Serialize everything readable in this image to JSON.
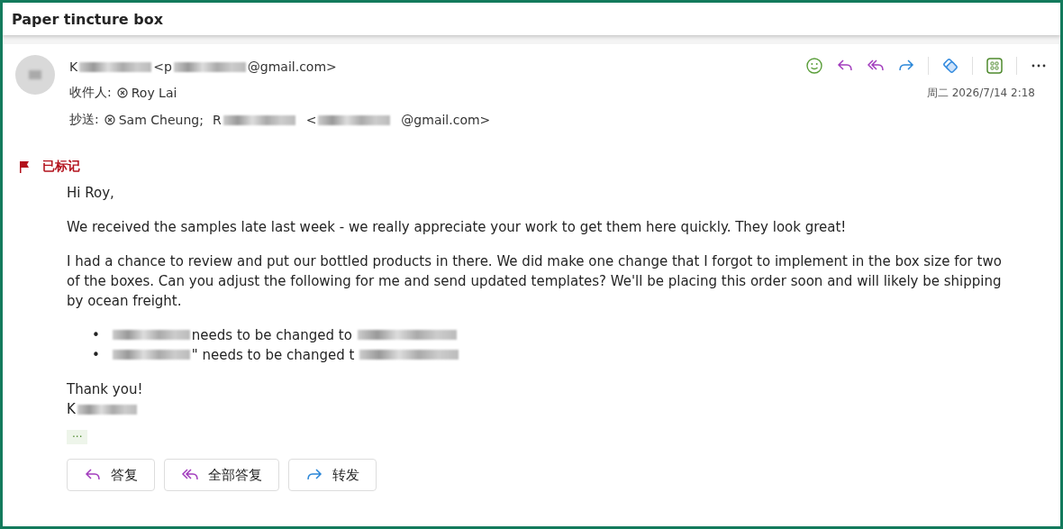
{
  "subject": "Paper tincture box",
  "sender": [
    {
      "kind": "text",
      "text": "K"
    },
    {
      "kind": "redacted"
    },
    {
      "kind": "text",
      "text": "<p"
    },
    {
      "kind": "redacted"
    },
    {
      "kind": "text",
      "text": "@gmail.com>"
    }
  ],
  "to": {
    "label": "收件人:",
    "recipients": [
      {
        "name": "Roy Lai"
      }
    ]
  },
  "cc": {
    "label": "抄送:",
    "parts": [
      {
        "kind": "chip",
        "text": "Sam Cheung;"
      },
      {
        "kind": "text",
        "text": "R"
      },
      {
        "kind": "redacted"
      },
      {
        "kind": "text",
        "text": "<"
      },
      {
        "kind": "redacted"
      },
      {
        "kind": "text",
        "text": "@gmail.com>"
      }
    ]
  },
  "toolbar": [
    {
      "kind": "emoji"
    },
    {
      "kind": "reply"
    },
    {
      "kind": "reply-all"
    },
    {
      "kind": "forward"
    },
    {
      "kind": "sep"
    },
    {
      "kind": "loop"
    },
    {
      "kind": "sep"
    },
    {
      "kind": "apps"
    },
    {
      "kind": "sep"
    },
    {
      "kind": "more"
    }
  ],
  "date": "周二 2026/7/14 2:18",
  "flag": {
    "flagged": true,
    "label": "已标记"
  },
  "body": {
    "greeting": "Hi Roy,",
    "paragraphs": [
      "We received the samples late last week - we really appreciate your work to get them here quickly. They look great!",
      "I had a chance to review and put our bottled products in there. We did make one change that I forgot to implement in the box size for two of the boxes. Can you adjust the following for me and send updated templates? We'll be placing this order soon and will likely be shipping by ocean freight."
    ],
    "bullets": [
      {
        "marker": "•",
        "parts": [
          {
            "kind": "redacted"
          },
          {
            "kind": "text",
            "text": "needs to be changed to"
          },
          {
            "kind": "redacted"
          }
        ]
      },
      {
        "marker": "•",
        "parts": [
          {
            "kind": "redacted"
          },
          {
            "kind": "text",
            "text": "\" needs to be changed t"
          },
          {
            "kind": "redacted"
          }
        ]
      }
    ],
    "closing": "Thank you!",
    "signature": [
      {
        "kind": "text",
        "text": "K"
      },
      {
        "kind": "redacted"
      }
    ]
  },
  "expand": "···",
  "actions": [
    {
      "kind": "reply",
      "label": "答复"
    },
    {
      "kind": "reply-all",
      "label": "全部答复"
    },
    {
      "kind": "forward",
      "label": "转发"
    }
  ]
}
